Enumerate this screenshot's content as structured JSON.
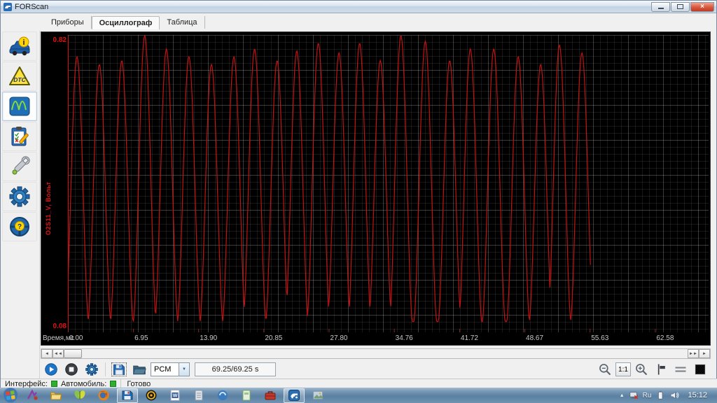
{
  "titlebar": {
    "title": "FORScan"
  },
  "glyphs": {
    "close": "×",
    "info": "i",
    "dtc": "DTC",
    "question": "?",
    "word": "W",
    "combo_arrow": "▼",
    "tray_expand": "▲",
    "scroll_left": "◄",
    "scroll_left_fast": "◄◄",
    "scroll_right_fast": "►►",
    "scroll_right": "►"
  },
  "tabs": {
    "items": [
      {
        "label": "Приборы"
      },
      {
        "label": "Осциллограф"
      },
      {
        "label": "Таблица"
      }
    ],
    "selected": "Осциллограф"
  },
  "sidebar": {
    "items": [
      {
        "name": "vehicle-info"
      },
      {
        "name": "dtc"
      },
      {
        "name": "oscilloscope",
        "selected": true
      },
      {
        "name": "tests"
      },
      {
        "name": "service"
      },
      {
        "name": "settings"
      },
      {
        "name": "about"
      }
    ]
  },
  "toolbar": {
    "module_selector": "PCM",
    "time_indicator": "69.25/69.25 s",
    "zoom_ratio": "1:1"
  },
  "statusbar": {
    "interface_label": "Интерфейс:",
    "vehicle_label": "Автомобиль:",
    "status": "Готово"
  },
  "taskbar": {
    "language": "Ru",
    "clock": "15:12"
  },
  "chart_data": {
    "type": "line",
    "xlabel": "Время,мс",
    "x_ticks": [
      {
        "label": "0.00",
        "value": 0
      },
      {
        "label": "6.95",
        "value": 6.95
      },
      {
        "label": "13.90",
        "value": 13.9
      },
      {
        "label": "20.85",
        "value": 20.85
      },
      {
        "label": "27.80",
        "value": 27.8
      },
      {
        "label": "34.76",
        "value": 34.76
      },
      {
        "label": "41.72",
        "value": 41.72
      },
      {
        "label": "48.67",
        "value": 48.67
      },
      {
        "label": "55.63",
        "value": 55.63
      },
      {
        "label": "62.58",
        "value": 62.58
      }
    ],
    "xlim": [
      0,
      68.3
    ],
    "ylim": [
      0.065,
      0.845
    ],
    "y_ref_max": {
      "label": "0.82",
      "value": 0.82
    },
    "y_ref_min": {
      "label": "0.08",
      "value": 0.08
    },
    "grid": true,
    "bg_color": "#000000",
    "series": [
      {
        "name": "O2S11_V, Вольт",
        "color": "#cc1313",
        "baseline": 0.095,
        "trace_end": 55.75,
        "peaks": [
          [
            0.97,
            0.78
          ],
          [
            3.35,
            0.76
          ],
          [
            5.74,
            0.77
          ],
          [
            8.19,
            0.835
          ],
          [
            10.5,
            0.8
          ],
          [
            12.9,
            0.78
          ],
          [
            15.3,
            0.76
          ],
          [
            17.7,
            0.78
          ],
          [
            19.9,
            0.8
          ],
          [
            22.3,
            0.77
          ],
          [
            24.4,
            0.795
          ],
          [
            26.7,
            0.815
          ],
          [
            28.9,
            0.79
          ],
          [
            31.1,
            0.815
          ],
          [
            33.3,
            0.77
          ],
          [
            35.5,
            0.835
          ],
          [
            38.1,
            0.82
          ],
          [
            40.7,
            0.77
          ],
          [
            42.9,
            0.8
          ],
          [
            45.4,
            0.8
          ],
          [
            48.0,
            0.78
          ],
          [
            50.4,
            0.76
          ],
          [
            52.4,
            0.81
          ],
          [
            54.8,
            0.79
          ]
        ]
      }
    ]
  }
}
